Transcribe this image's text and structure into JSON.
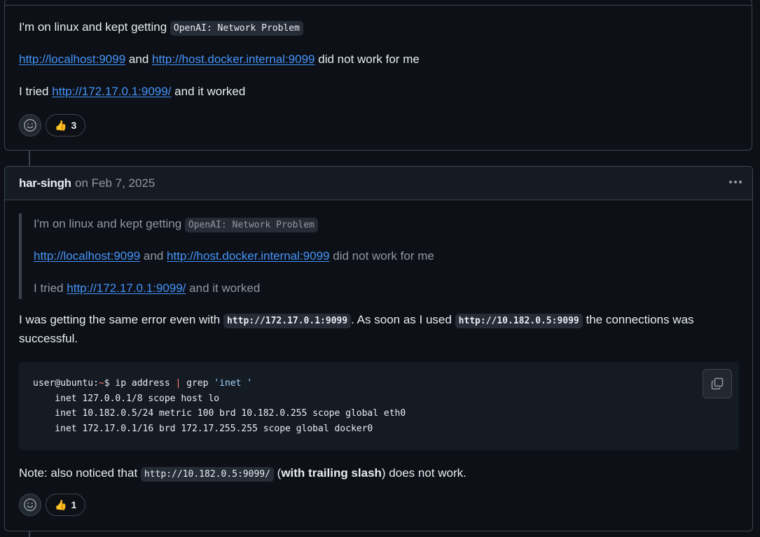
{
  "comment1": {
    "line1_text": "I'm on linux and kept getting",
    "line1_code": "OpenAI: Network Problem",
    "link_localhost": "http://localhost:9099",
    "and_text": "and",
    "link_docker": "http://host.docker.internal:9099",
    "did_not_work": "did not work for me",
    "tried_text": "I tried",
    "link_ip": "http://172.17.0.1:9099/",
    "worked_text": "and it worked",
    "reaction_emoji": "👍",
    "reaction_count": "3"
  },
  "comment2": {
    "author": "har-singh",
    "date": "on Feb 7, 2025",
    "quote": {
      "line1_text": "I'm on linux and kept getting",
      "line1_code": "OpenAI: Network Problem",
      "link_localhost": "http://localhost:9099",
      "and_text": "and",
      "link_docker": "http://host.docker.internal:9099",
      "did_not_work": "did not work for me",
      "tried_text": "I tried",
      "link_ip": "http://172.17.0.1:9099/",
      "worked_text": "and it worked"
    },
    "para1_a": "I was getting the same error even with",
    "para1_code1": "http://172.17.0.1:9099",
    "para1_b": ". As soon as I used",
    "para1_code2": "http://10.182.0.5:9099",
    "para1_c": "the connections was",
    "para1_d": "successful.",
    "code": {
      "prompt_user": "user@ubuntu:",
      "prompt_tilde": "~",
      "prompt_dollar": "$ ip address ",
      "pipe": "|",
      "cmd2": " grep ",
      "arg": "'inet '",
      "out1": "    inet 127.0.0.1/8 scope host lo",
      "out2": "    inet 10.182.0.5/24 metric 100 brd 10.182.0.255 scope global eth0",
      "out3": "    inet 172.17.0.1/16 brd 172.17.255.255 scope global docker0"
    },
    "note_a": "Note: also noticed that",
    "note_code": "http://10.182.0.5:9099/",
    "note_b": "(",
    "note_bold": "with trailing slash",
    "note_c": ") does not work.",
    "reaction_emoji": "👍",
    "reaction_count": "1"
  },
  "icons": {
    "emoji_picker": "smiley-icon",
    "copy": "copy-icon",
    "more": "kebab-horizontal-icon"
  },
  "colors": {
    "background": "#0d1117",
    "link": "#4493f8",
    "border": "#3d444d",
    "muted": "#9198a1"
  }
}
